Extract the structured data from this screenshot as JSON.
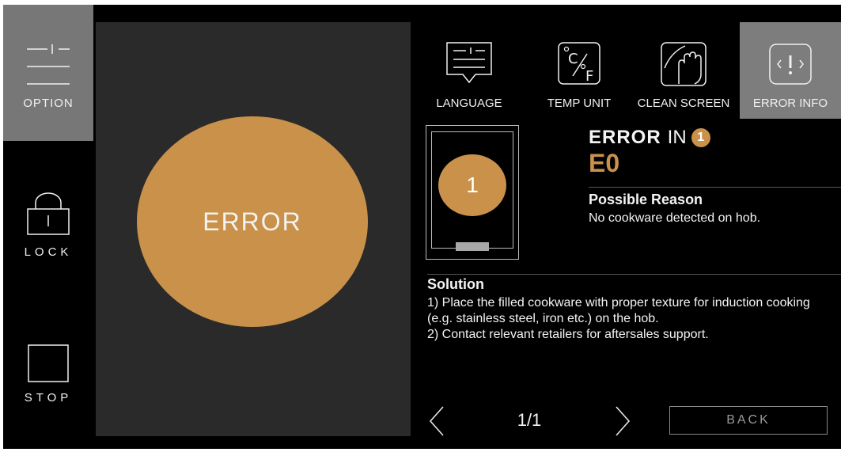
{
  "nav": {
    "option_label": "OPTION",
    "lock_label": "LOCK",
    "stop_label": "STOP"
  },
  "center": {
    "status": "ERROR"
  },
  "tabs": [
    {
      "label": "LANGUAGE",
      "icon": "language-icon"
    },
    {
      "label": "TEMP UNIT",
      "icon": "temp-unit-icon"
    },
    {
      "label": "CLEAN SCREEN",
      "icon": "clean-screen-icon"
    },
    {
      "label": "ERROR INFO",
      "icon": "error-info-icon",
      "active": true
    }
  ],
  "error": {
    "title": "ERROR",
    "in_label": "IN",
    "zone": "1",
    "code": "E0",
    "reason_heading": "Possible Reason",
    "reason_text": "No cookware detected on hob.",
    "solution_heading": "Solution",
    "solution_lines": [
      "1) Place the filled cookware with proper texture for induction cooking (e.g. stainless steel, iron etc.) on the hob.",
      "2) Contact relevant retailers for aftersales support."
    ]
  },
  "diagram": {
    "zone_label": "1"
  },
  "footer": {
    "page": "1/1",
    "back_label": "BACK"
  },
  "colors": {
    "accent": "#c9914a",
    "background": "#000000",
    "panel": "#2a2a2a",
    "active_tab": "#7d7d7d"
  }
}
